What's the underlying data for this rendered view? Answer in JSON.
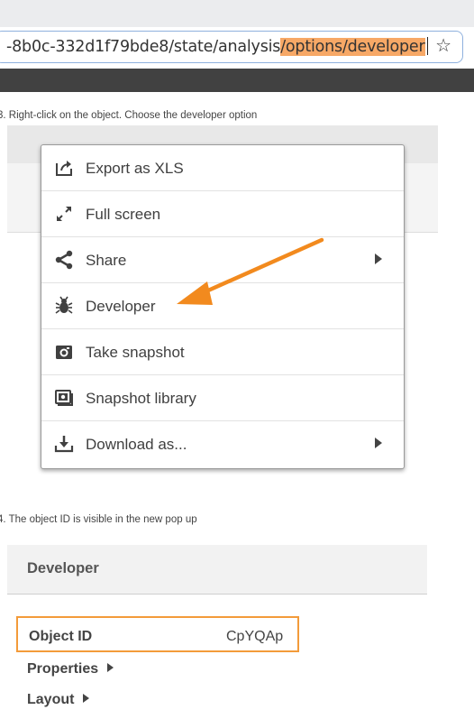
{
  "browser": {
    "url_prefix": "-8b0c-332d1f79bde8/state/analysis",
    "url_highlight": "/options/developer",
    "bookmark_icon": "star-icon"
  },
  "steps": {
    "step1": "3. Right-click on the object. Choose the developer option",
    "step2": "4. The object ID is visible in the new pop up"
  },
  "menu": {
    "items": [
      {
        "label": "Export as XLS",
        "icon": "export-icon",
        "submenu": false
      },
      {
        "label": "Full screen",
        "icon": "fullscreen-icon",
        "submenu": false
      },
      {
        "label": "Share",
        "icon": "share-icon",
        "submenu": true
      },
      {
        "label": "Developer",
        "icon": "bug-icon",
        "submenu": false
      },
      {
        "label": "Take snapshot",
        "icon": "camera-icon",
        "submenu": false
      },
      {
        "label": "Snapshot library",
        "icon": "snapshot-library-icon",
        "submenu": false
      },
      {
        "label": "Download as...",
        "icon": "download-icon",
        "submenu": true
      }
    ]
  },
  "developer_panel": {
    "title": "Developer",
    "object_id_label": "Object ID",
    "object_id_value": "CpYQAp",
    "properties_label": "Properties",
    "layout_label": "Layout"
  },
  "colors": {
    "highlight": "#f7a866",
    "arrow": "#f28a1e",
    "box_border": "#f39b3a",
    "dark_bar": "#414141"
  }
}
